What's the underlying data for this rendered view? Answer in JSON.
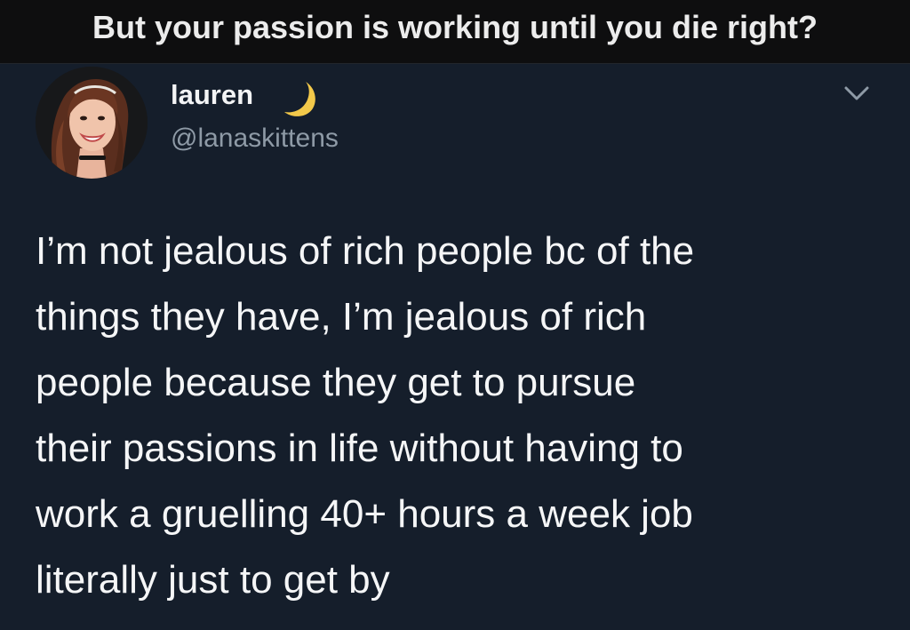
{
  "caption": {
    "text": "But your passion is working until you die right?"
  },
  "tweet": {
    "display_name": "lauren",
    "name_emoji_icon": "crescent-moon-icon",
    "handle": "@lanaskittens",
    "menu_icon": "chevron-down-icon",
    "body": "I’m not jealous of rich people bc of the\nthings they have, I’m jealous of rich\npeople because they get to pursue\ntheir passions in life without having to\nwork a gruelling 40+ hours a week job\nliterally just to get by"
  },
  "colors": {
    "caption_background": "#0e0e0f",
    "tweet_background": "#151e2b",
    "primary_text": "#f5f6f7",
    "secondary_text": "#8e9aa6",
    "moon": "#f3c94a"
  }
}
